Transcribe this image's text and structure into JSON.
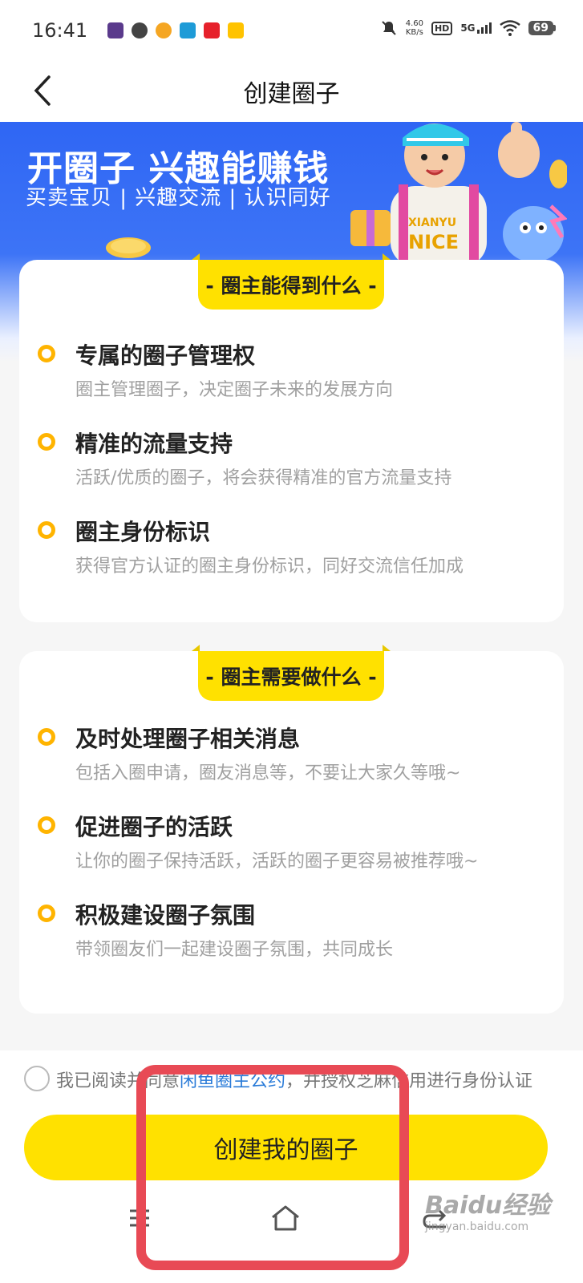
{
  "status_bar": {
    "time": "16:41",
    "net_speed_value": "4.60",
    "net_speed_unit": "KB/s",
    "hd_label": "HD",
    "network": "5G",
    "battery": "69"
  },
  "nav": {
    "title": "创建圈子"
  },
  "banner": {
    "title": "开圈子 兴趣能赚钱",
    "subtitle": "买卖宝贝 | 兴趣交流 | 认识同好",
    "mascot_text_1": "XIANYU",
    "mascot_text_2": "NICE"
  },
  "sections": [
    {
      "header": "- 圈主能得到什么 -",
      "items": [
        {
          "title": "专属的圈子管理权",
          "desc": "圈主管理圈子，决定圈子未来的发展方向"
        },
        {
          "title": "精准的流量支持",
          "desc": "活跃/优质的圈子，将会获得精准的官方流量支持"
        },
        {
          "title": "圈主身份标识",
          "desc": "获得官方认证的圈主身份标识，同好交流信任加成"
        }
      ]
    },
    {
      "header": "- 圈主需要做什么 -",
      "items": [
        {
          "title": "及时处理圈子相关消息",
          "desc": "包括入圈申请，圈友消息等，不要让大家久等哦~"
        },
        {
          "title": "促进圈子的活跃",
          "desc": "让你的圈子保持活跃，活跃的圈子更容易被推荐哦~"
        },
        {
          "title": "积极建设圈子氛围",
          "desc": "带领圈友们一起建设圈子氛围，共同成长"
        }
      ]
    }
  ],
  "agreement": {
    "prefix": "我已阅读并同意",
    "link": "闲鱼圈主公约",
    "suffix": "，并授权芝麻信用进行身份认证"
  },
  "create_button": "创建我的圈子",
  "watermark": {
    "main": "Baidu经验",
    "sub": "jingyan.baidu.com"
  },
  "colors": {
    "accent_yellow": "#ffe100",
    "bullet_orange": "#ffb400",
    "banner_blue": "#2f66f4",
    "highlight_red": "#e84a55",
    "link_blue": "#2a7bd8"
  }
}
